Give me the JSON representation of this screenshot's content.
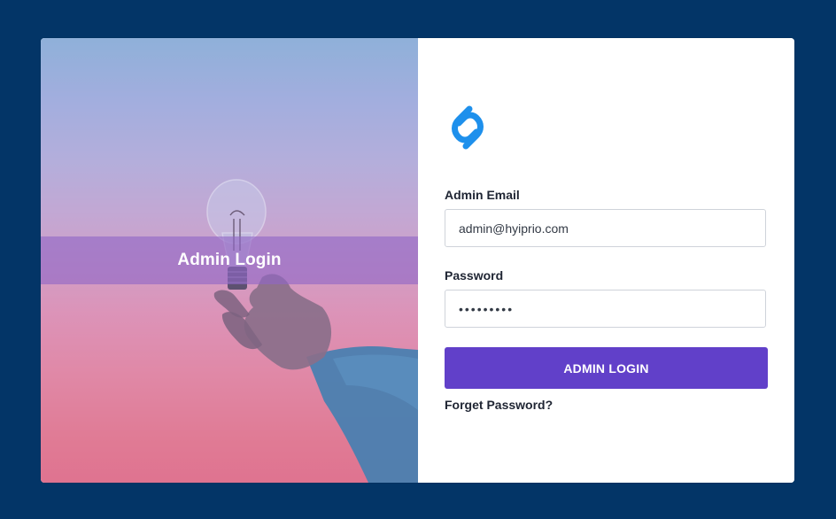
{
  "hero": {
    "title": "Admin Login"
  },
  "logo": {
    "icon": "brand-logo-icon",
    "color": "#1e90ec"
  },
  "form": {
    "email_label": "Admin Email",
    "email_value": "admin@hyiprio.com",
    "password_label": "Password",
    "password_value": "•••••••••",
    "submit_label": "ADMIN LOGIN",
    "forgot_label": "Forget Password?"
  },
  "colors": {
    "page_background": "#033567",
    "button": "#6140c9",
    "hero_band": "#8f66c7"
  }
}
